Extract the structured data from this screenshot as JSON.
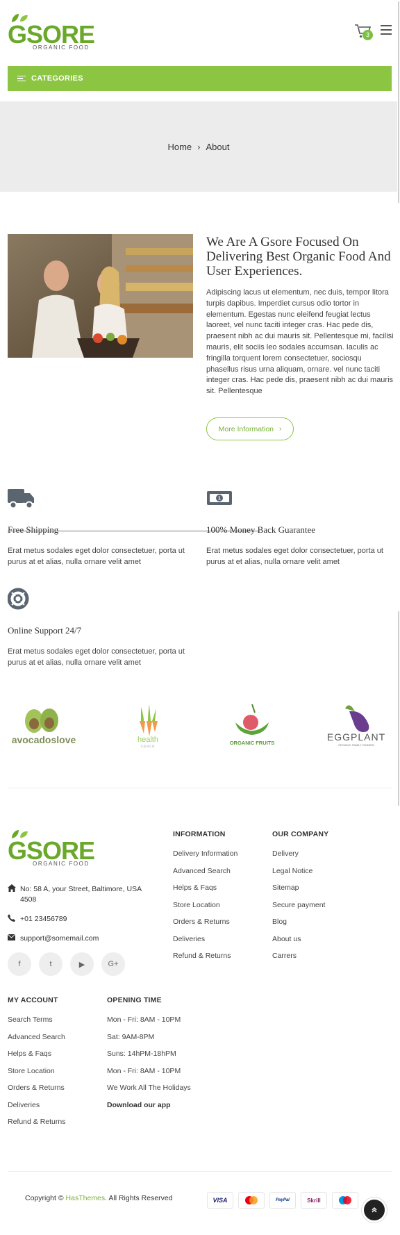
{
  "header": {
    "logo_text": "GSORE",
    "logo_sub": "ORGANIC FOOD",
    "cart_count": "3",
    "categories_label": "CATEGORIES"
  },
  "breadcrumb": {
    "home": "Home",
    "current": "About"
  },
  "about": {
    "title": "We Are A Gsore Focused On Delivering Best Organic Food And User Experiences.",
    "text": "Adipiscing lacus ut elementum, nec duis, tempor litora turpis dapibus. Imperdiet cursus odio tortor in elementum. Egestas nunc eleifend feugiat lectus laoreet, vel nunc taciti integer cras. Hac pede dis, praesent nibh ac dui mauris sit. Pellentesque mi, facilisi mauris, elit sociis leo sodales accumsan. Iaculis ac fringilla torquent lorem consectetuer, sociosqu phasellus risus urna aliquam, ornare. vel nunc taciti integer cras. Hac pede dis, praesent nibh ac dui mauris sit. Pellentesque",
    "button": "More Information",
    "button_icon": "chevron-right-icon"
  },
  "features": [
    {
      "icon": "truck-icon",
      "title": "Free Shipping",
      "desc": "Erat metus sodales eget dolor consectetuer, porta ut purus at et alias, nulla ornare velit amet"
    },
    {
      "icon": "money-icon",
      "title": "100% Money Back Guarantee",
      "desc": "Erat metus sodales eget dolor consectetuer, porta ut purus at et alias, nulla ornare velit amet"
    },
    {
      "icon": "lifebuoy-icon",
      "title": "Online Support 24/7",
      "desc": "Erat metus sodales eget dolor consectetuer, porta ut purus at et alias, nulla ornare velit amet"
    }
  ],
  "brands": [
    {
      "name": "avocadoslove"
    },
    {
      "name": "health",
      "sub": "space"
    },
    {
      "name": "ORGANIC FRUITS"
    },
    {
      "name": "EGGPLANT",
      "sub": "ORGANIC FAMILY GARDEN"
    }
  ],
  "footer": {
    "logo_text": "GSORE",
    "logo_sub": "ORGANIC FOOD",
    "address": "No: 58 A, your Street, Baltimore, USA 4508",
    "phone": "+01 23456789",
    "email": "support@somemail.com",
    "socials": [
      {
        "icon": "facebook-icon",
        "glyph": "f"
      },
      {
        "icon": "twitter-icon",
        "glyph": "t"
      },
      {
        "icon": "youtube-icon",
        "glyph": "▶"
      },
      {
        "icon": "google-plus-icon",
        "glyph": "G+"
      }
    ],
    "information": {
      "heading": "INFORMATION",
      "items": [
        "Delivery Information",
        "Advanced Search",
        "Helps & Faqs",
        "Store Location",
        "Orders & Returns",
        "Deliveries",
        "Refund & Returns"
      ]
    },
    "company": {
      "heading": "OUR COMPANY",
      "items": [
        "Delivery",
        "Legal Notice",
        "Sitemap",
        "Secure payment",
        "Blog",
        "About us",
        "Carrers"
      ]
    },
    "account": {
      "heading": "MY ACCOUNT",
      "items": [
        "Search Terms",
        "Advanced Search",
        "Helps & Faqs",
        "Store Location",
        "Orders & Returns",
        "Deliveries",
        "Refund & Returns"
      ]
    },
    "opening": {
      "heading": "OPENING TIME",
      "items": [
        "Mon - Fri: 8AM - 10PM",
        "Sat: 9AM-8PM",
        "Suns: 14hPM-18hPM",
        "Mon - Fri: 8AM - 10PM",
        "We Work All The Holidays"
      ],
      "app_label": "Download our app"
    },
    "copyright_prefix": "Copyright ©",
    "copyright_brand": "HasThemes",
    "copyright_suffix": ". All Rights Reserved",
    "payments": [
      {
        "name": "VISA",
        "color": "#1a1f71"
      },
      {
        "name": "mastercard",
        "color": "#eb001b"
      },
      {
        "name": "PayPal",
        "color": "#003087"
      },
      {
        "name": "Skrill",
        "color": "#862165"
      },
      {
        "name": "maestro",
        "color": "#0099df"
      }
    ]
  },
  "colors": {
    "accent": "#8cc541",
    "accent_text": "#7ab13a",
    "breadcrumb_bg": "#ececec"
  }
}
